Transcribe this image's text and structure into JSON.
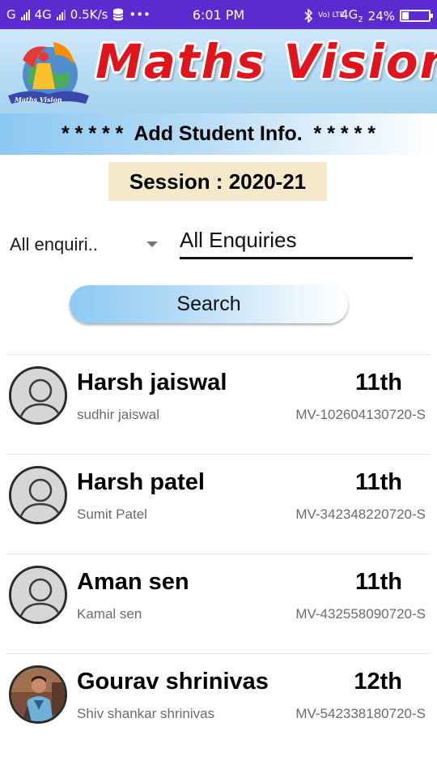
{
  "status_bar": {
    "left_carrier": "G",
    "network_left": "4G",
    "speed": "0.5K/s",
    "more": "•••",
    "time": "6:01 PM",
    "volte": "Vo) LTE",
    "network_right": "4G",
    "network_right_sub": "2",
    "battery_percent": "24%",
    "battery_level": 0.24
  },
  "banner": {
    "brand_title": "Maths Vision",
    "logo_text": "Maths Vision"
  },
  "page_heading": "* * * * *  Add Student Info.  * * * * *",
  "session_label": "Session : 2020-21",
  "filter": {
    "dropdown_value": "All enquiri..",
    "text_value": "All Enquiries"
  },
  "search_label": "Search",
  "students": [
    {
      "name": "Harsh jaiswal",
      "grade": "11th",
      "parent": "sudhir jaiswal",
      "id": "MV-102604130720-S",
      "has_photo": false
    },
    {
      "name": "Harsh patel",
      "grade": "11th",
      "parent": "Sumit Patel",
      "id": "MV-342348220720-S",
      "has_photo": false
    },
    {
      "name": "Aman sen",
      "grade": "11th",
      "parent": "Kamal sen",
      "id": "MV-432558090720-S",
      "has_photo": false
    },
    {
      "name": "Gourav shrinivas",
      "grade": "12th",
      "parent": "Shiv shankar shrinivas",
      "id": "MV-542338180720-S",
      "has_photo": true
    }
  ],
  "colors": {
    "status_bar": "#5b2bd0",
    "brand_red": "#e0141d",
    "session_bg": "#f6e9c9",
    "accent_blue": "#8ccaf3"
  }
}
